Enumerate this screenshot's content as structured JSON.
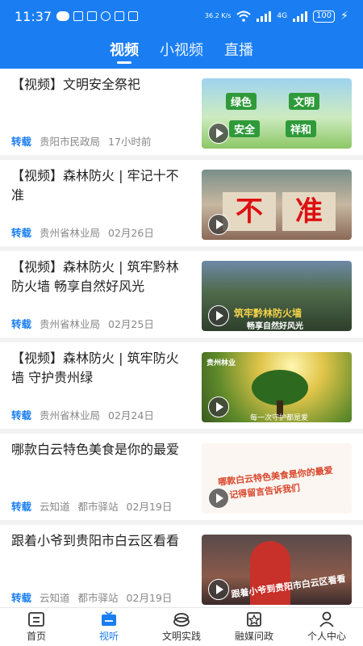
{
  "status": {
    "time": "11:37",
    "speed": "36.2 K/s",
    "battery": "100",
    "signal": "4G"
  },
  "tabs": [
    {
      "label": "视频"
    },
    {
      "label": "小视频"
    },
    {
      "label": "直播"
    }
  ],
  "items": [
    {
      "title": "【视频】文明安全祭祀",
      "tag": "转载",
      "source": "贵阳市民政局",
      "time": "17小时前",
      "thumb": {
        "labels": [
          "绿色",
          "文明",
          "安全",
          "祥和"
        ]
      }
    },
    {
      "title": "【视频】森林防火 | 牢记十不准",
      "tag": "转载",
      "source": "贵州省林业局",
      "time": "02月26日",
      "thumb": {
        "labels": [
          "不",
          "准"
        ]
      }
    },
    {
      "title": "【视频】森林防火 | 筑牢黔林防火墙  畅享自然好风光",
      "tag": "转载",
      "source": "贵州省林业局",
      "time": "02月25日",
      "thumb": {
        "labels": [
          "筑牢黔林防火墙",
          "畅享自然好风光"
        ]
      }
    },
    {
      "title": "【视频】森林防火 | 筑牢防火墙  守护贵州绿",
      "tag": "转载",
      "source": "贵州省林业局",
      "time": "02月24日",
      "thumb": {
        "labels": [
          "贵州林业",
          "每一次守护都是爱"
        ]
      }
    },
    {
      "title": "哪款白云特色美食是你的最爱",
      "tag": "转载",
      "source": "云知道",
      "source2": "都市驿站",
      "time": "02月19日",
      "thumb": {
        "labels": [
          "哪款白云特色美食是你的最爱",
          "记得留言告诉我们"
        ]
      }
    },
    {
      "title": "跟着小爷到贵阳市白云区看看",
      "tag": "转载",
      "source": "云知道",
      "source2": "都市驿站",
      "time": "02月19日",
      "thumb": {
        "labels": [
          "跟着小爷到贵阳市白云区看看"
        ]
      }
    }
  ],
  "tabbar": [
    {
      "label": "首页",
      "icon": "home-icon"
    },
    {
      "label": "视听",
      "icon": "tv-icon"
    },
    {
      "label": "文明实践",
      "icon": "practice-icon"
    },
    {
      "label": "融媒问政",
      "icon": "star-icon"
    },
    {
      "label": "个人中心",
      "icon": "person-icon"
    }
  ],
  "colors": {
    "accent": "#1a7ef2",
    "tag": "#1a7ef2"
  }
}
